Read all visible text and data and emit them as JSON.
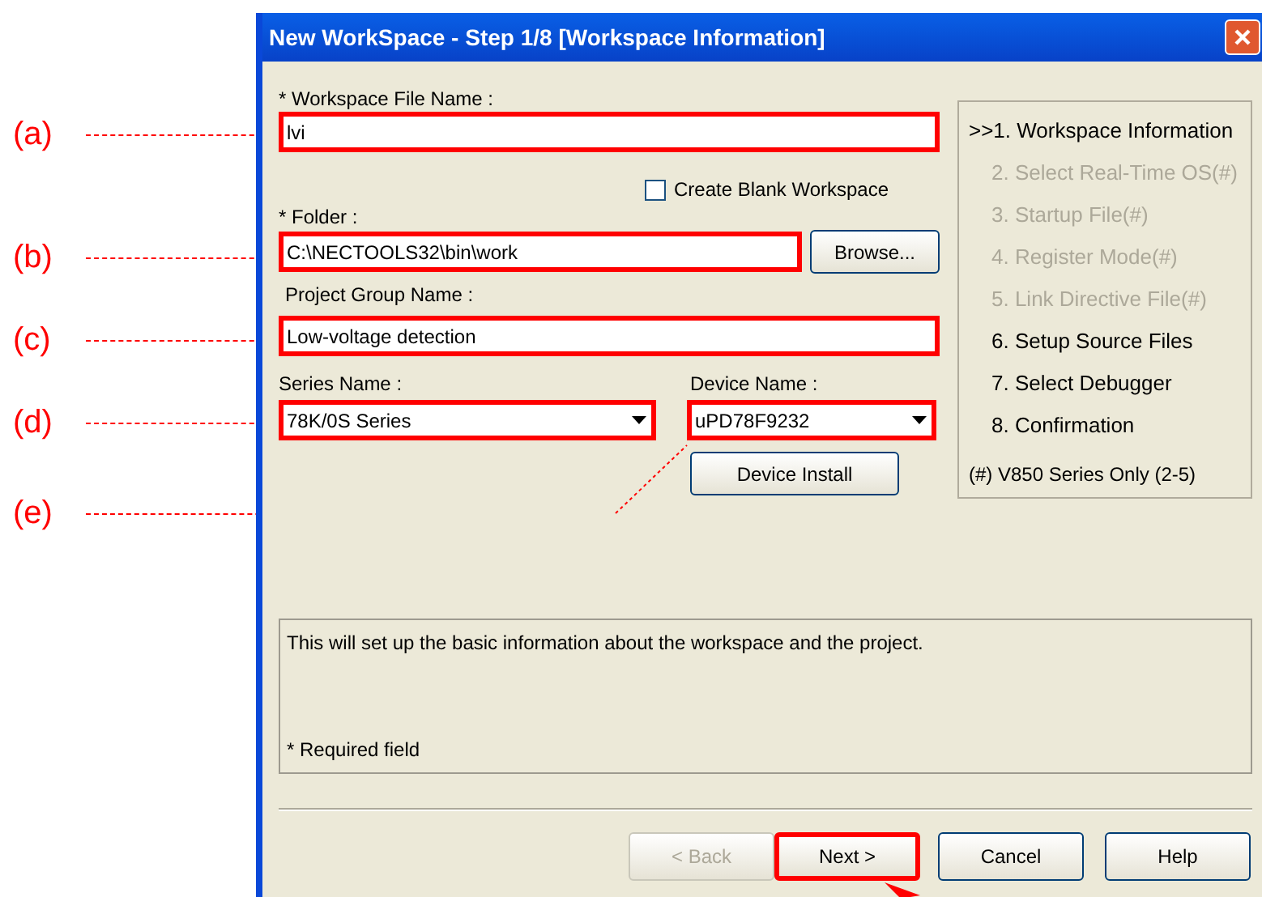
{
  "window": {
    "title": "New WorkSpace - Step 1/8 [Workspace Information]"
  },
  "workspace_file": {
    "label": "* Workspace File Name :",
    "value": "lvi",
    "highlighted": true
  },
  "create_blank": {
    "label": "Create Blank Workspace",
    "checked": false
  },
  "folder": {
    "label": "* Folder :",
    "value": "C:\\NECTOOLS32\\bin\\work",
    "highlighted": true,
    "browse": "Browse..."
  },
  "project_group": {
    "label": "Project Group Name :",
    "value": "Low-voltage detection",
    "highlighted": true
  },
  "series": {
    "label": "Series Name :",
    "value": "78K/0S Series",
    "highlighted": true
  },
  "device": {
    "label": "Device Name :",
    "value": "uPD78F9232",
    "highlighted": true,
    "install": "Device Install"
  },
  "steps": [
    {
      "label": ">>1. Workspace Information",
      "enabled": true
    },
    {
      "label": "2. Select Real-Time OS(#)",
      "enabled": false
    },
    {
      "label": "3. Startup File(#)",
      "enabled": false
    },
    {
      "label": "4. Register Mode(#)",
      "enabled": false
    },
    {
      "label": "5. Link Directive File(#)",
      "enabled": false
    },
    {
      "label": "6. Setup Source Files",
      "enabled": true
    },
    {
      "label": "7. Select Debugger",
      "enabled": true
    },
    {
      "label": "8. Confirmation",
      "enabled": true
    }
  ],
  "steps_note": "(#) V850 Series Only (2-5)",
  "description": [
    "This will set up the basic information about the workspace and the project.",
    "* Required field"
  ],
  "buttons": [
    {
      "label": "< Back",
      "disabled": true,
      "highlighted": false
    },
    {
      "label": "Next >",
      "disabled": false,
      "highlighted": true
    },
    {
      "label": "Cancel",
      "disabled": false,
      "highlighted": false
    },
    {
      "label": "Help",
      "disabled": false,
      "highlighted": false
    }
  ],
  "callouts": [
    {
      "label": "(a)"
    },
    {
      "label": "(b)"
    },
    {
      "label": "(c)"
    },
    {
      "label": "(d)"
    },
    {
      "label": "(e)"
    }
  ]
}
